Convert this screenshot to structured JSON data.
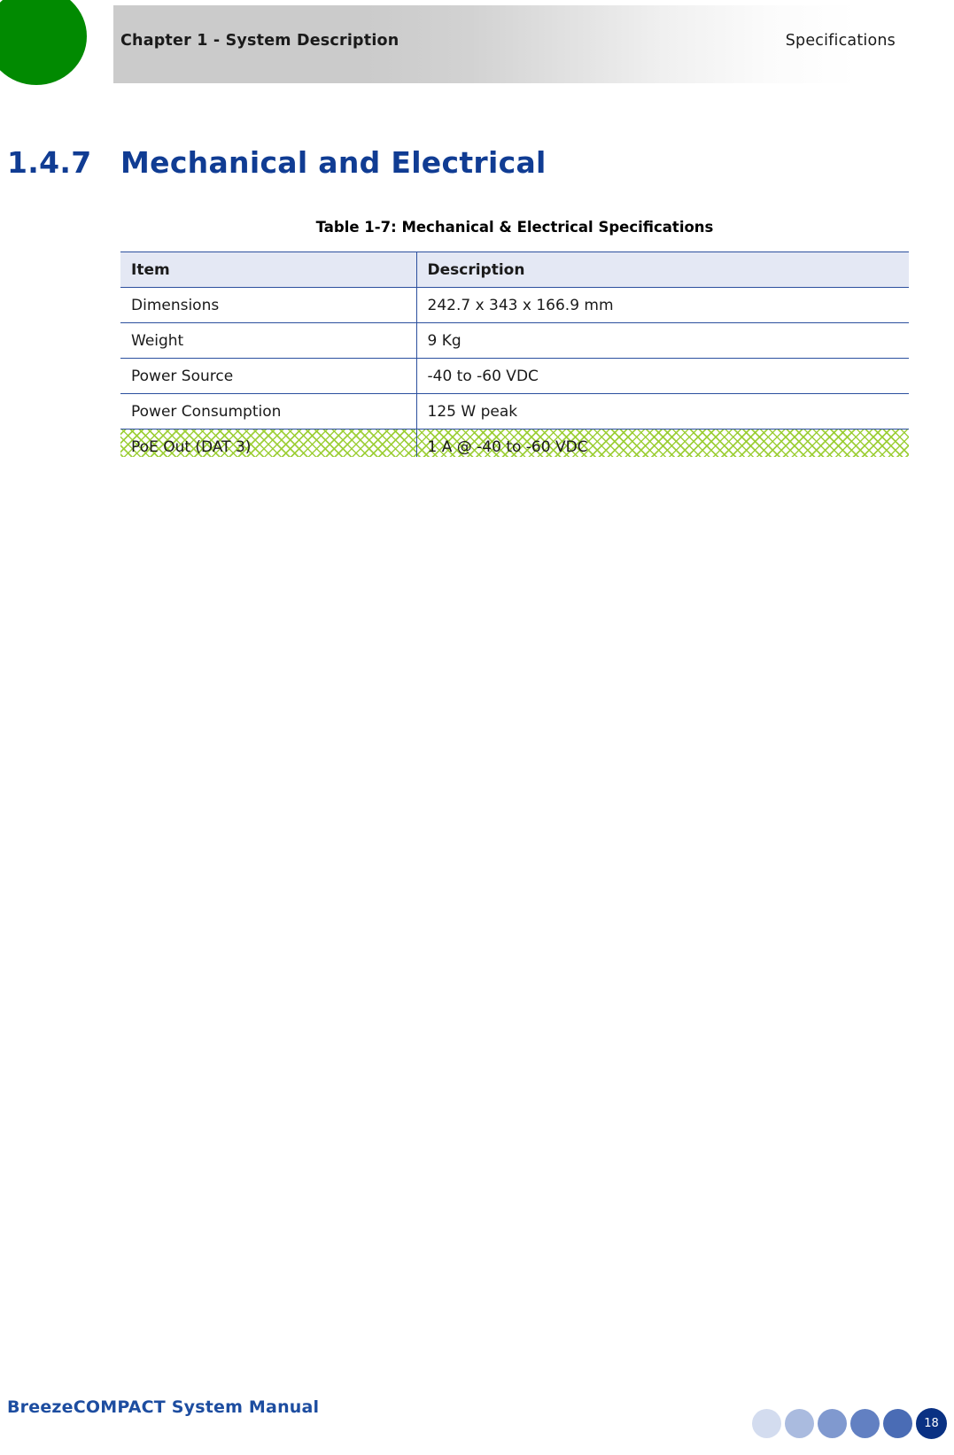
{
  "header": {
    "left_text": "Chapter 1 - System Description",
    "right_text": "Specifications",
    "dot_color": "#018a01"
  },
  "section": {
    "number": "1.4.7",
    "title": "Mechanical and Electrical",
    "color": "#103c93"
  },
  "table": {
    "caption": "Table 1-7: Mechanical & Electrical Specifications",
    "columns": [
      "Item",
      "Description"
    ],
    "header_bg": "#e4e8f4",
    "border_color": "#2b4f9e",
    "highlight_color": "#9acd32",
    "rows": [
      {
        "item": "Dimensions",
        "description": "242.7 x 343 x 166.9 mm",
        "highlighted": false
      },
      {
        "item": "Weight",
        "description": "9 Kg",
        "highlighted": false
      },
      {
        "item": "Power Source",
        "description": "-40 to -60 VDC",
        "highlighted": false
      },
      {
        "item": "Power Consumption",
        "description": "125 W peak",
        "highlighted": false
      },
      {
        "item": "PoE Out (DAT 3)",
        "description": "1 A @ -40 to -60 VDC",
        "highlighted": true
      }
    ]
  },
  "footer": {
    "title": "BreezeCOMPACT System Manual",
    "title_color": "#1d4da0",
    "page_number": "18",
    "dots": [
      {
        "color": "#d3dcef"
      },
      {
        "color": "#aabbdf"
      },
      {
        "color": "#8099cf"
      },
      {
        "color": "#6280c2"
      },
      {
        "color": "#4a6cb5"
      }
    ],
    "page_dot_color": "#0a3183"
  }
}
